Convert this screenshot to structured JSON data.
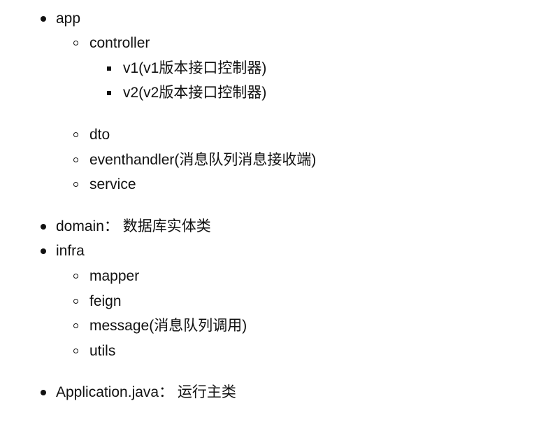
{
  "tree": {
    "app": "app",
    "controller": "controller",
    "v1": "v1(v1版本接口控制器)",
    "v2": "v2(v2版本接口控制器)",
    "dto": "dto",
    "eventhandler": "eventhandler(消息队列消息接收端)",
    "service": "service",
    "domain": "domain： 数据库实体类",
    "infra": "infra",
    "mapper": "mapper",
    "feign": "feign",
    "message": "message(消息队列调用)",
    "utils": "utils",
    "application": "Application.java： 运行主类"
  }
}
